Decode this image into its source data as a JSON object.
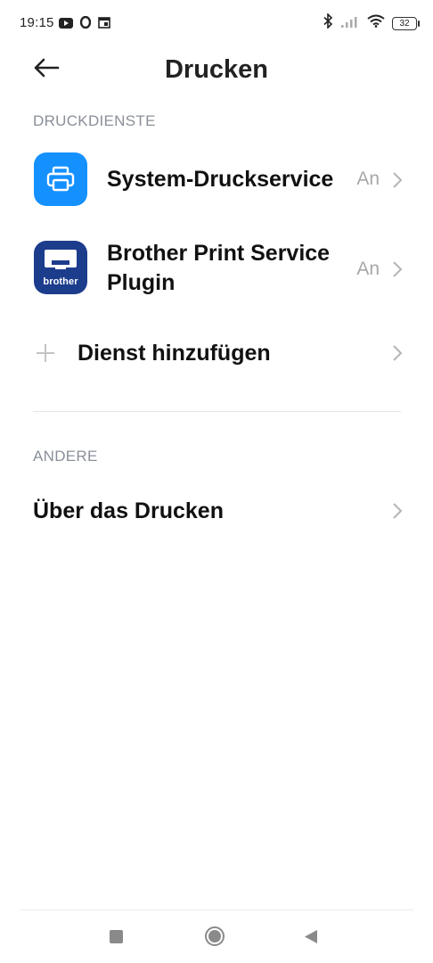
{
  "status_bar": {
    "time": "19:15",
    "battery_level": "32",
    "icons": [
      "youtube-icon",
      "opera-icon",
      "calendar-icon",
      "bluetooth-icon",
      "signal-icon",
      "wifi-icon",
      "battery-icon"
    ]
  },
  "header": {
    "title": "Drucken",
    "back_icon": "arrow-left-icon"
  },
  "sections": {
    "print_services": {
      "label": "DRUCKDIENSTE",
      "items": [
        {
          "title": "System-Druckservice",
          "status": "An",
          "icon": "printer-icon"
        },
        {
          "title_line1": "Brother Print Service",
          "title_line2": "Plugin",
          "status": "An",
          "icon": "brother-app-icon",
          "icon_text": "brother"
        }
      ],
      "add_service": {
        "label": "Dienst hinzufügen",
        "icon": "plus-icon"
      }
    },
    "other": {
      "label": "ANDERE",
      "items": [
        {
          "title": "Über das Drucken"
        }
      ]
    }
  },
  "nav": {
    "buttons": [
      "recents-icon",
      "home-icon",
      "back-triangle-icon"
    ]
  },
  "colors": {
    "accent_blue": "#1591ff",
    "brother_blue": "#1c3c8c",
    "section_gray": "#8a8f99",
    "status_gray": "#a7a7a7"
  }
}
